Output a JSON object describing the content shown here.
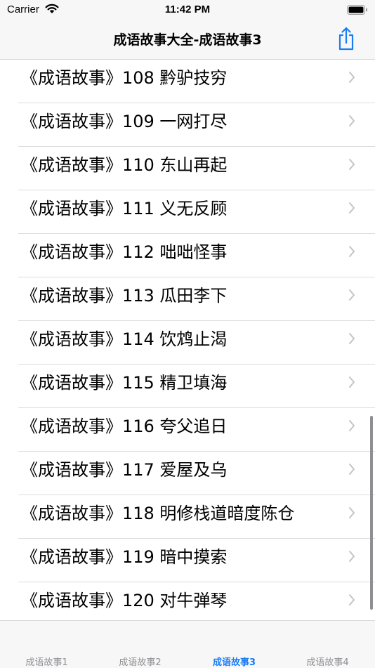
{
  "status": {
    "carrier": "Carrier",
    "time": "11:42 PM"
  },
  "nav": {
    "title": "成语故事大全-成语故事3"
  },
  "list": {
    "items": [
      {
        "label": "《成语故事》108 黔驴技穷"
      },
      {
        "label": "《成语故事》109 一网打尽"
      },
      {
        "label": "《成语故事》110 东山再起"
      },
      {
        "label": "《成语故事》111 义无反顾"
      },
      {
        "label": "《成语故事》112 咄咄怪事"
      },
      {
        "label": "《成语故事》113 瓜田李下"
      },
      {
        "label": "《成语故事》114 饮鸩止渴"
      },
      {
        "label": "《成语故事》115 精卫填海"
      },
      {
        "label": "《成语故事》116 夸父追日"
      },
      {
        "label": "《成语故事》117 爱屋及乌"
      },
      {
        "label": "《成语故事》118 明修栈道暗度陈仓"
      },
      {
        "label": "《成语故事》119 暗中摸索"
      },
      {
        "label": "《成语故事》120 对牛弹琴"
      }
    ]
  },
  "tabs": [
    {
      "label": "成语故事1"
    },
    {
      "label": "成语故事2"
    },
    {
      "label": "成语故事3"
    },
    {
      "label": "成语故事4"
    }
  ],
  "colors": {
    "accent": "#1a7cf5",
    "inactive": "#8e8e93"
  },
  "icons": {
    "share": "share-icon",
    "chevron": "chevron-right-icon",
    "wifi": "wifi-icon",
    "battery": "battery-icon"
  }
}
